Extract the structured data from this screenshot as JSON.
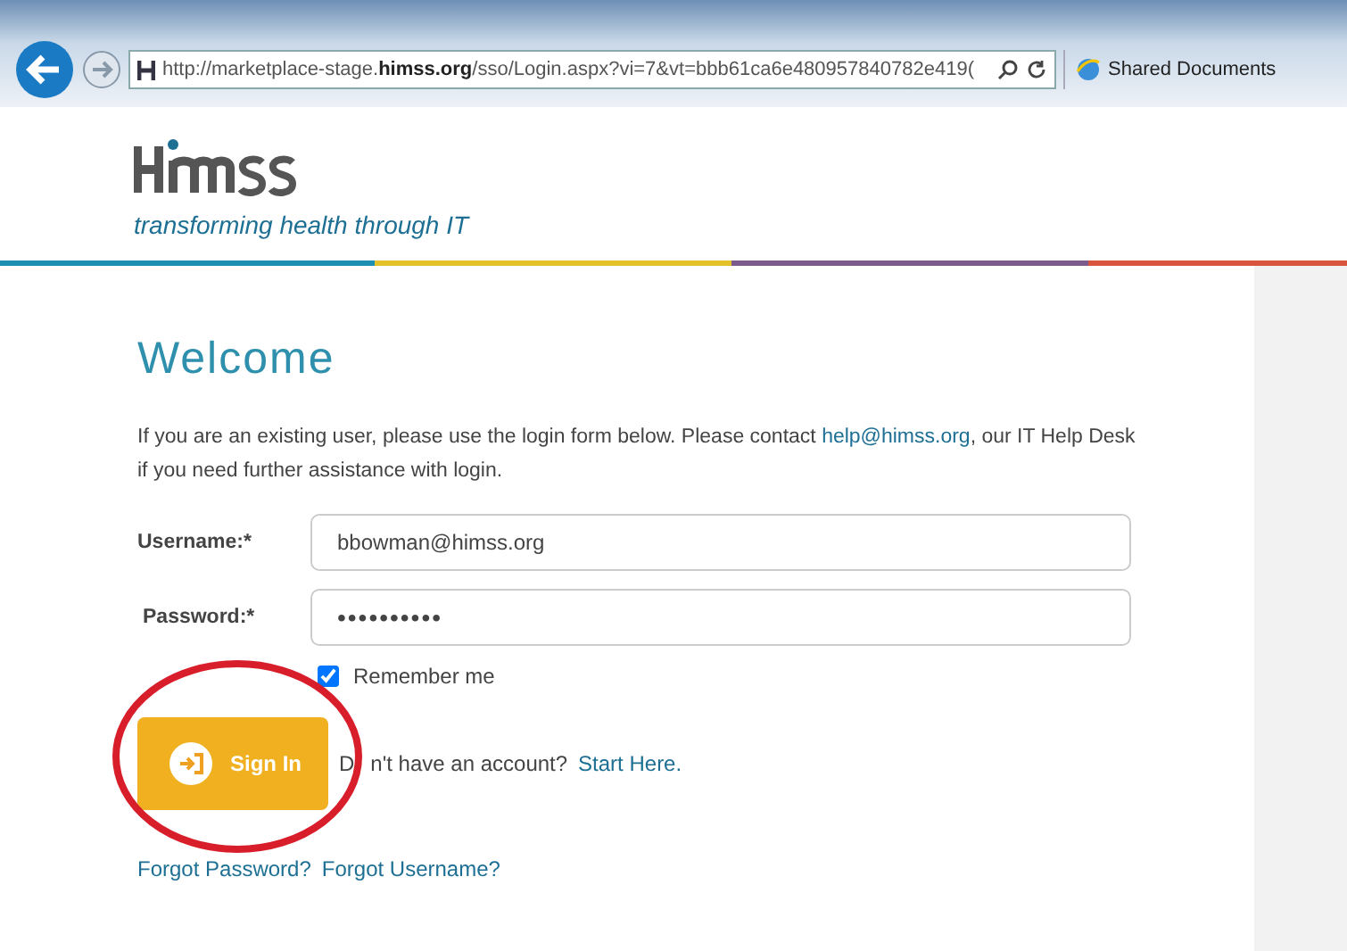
{
  "browser": {
    "address_prefix": "http://marketplace-stage.",
    "address_domain": "himss.org",
    "address_rest": "/sso/Login.aspx?vi=7&vt=bbb61ca6e480957840782e419(",
    "favorite": "Shared Documents"
  },
  "logo": {
    "tagline": "transforming health through IT"
  },
  "welcome": {
    "title": "Welcome",
    "intro_before": "If you are an existing user, please use the login form below. Please contact ",
    "intro_link": "help@himss.org",
    "intro_after": ", our IT Help Desk if you need further assistance with login."
  },
  "form": {
    "username_label": "Username:*",
    "username_value": "bbowman@himss.org",
    "password_label": "Password:*",
    "password_value": "••••••••••",
    "remember": {
      "label": "Remember me",
      "checked": true
    },
    "sign_in": "Sign In",
    "no_account_start": "D",
    "no_account_rest": "n't have an account?",
    "start_here": "Start Here.",
    "forgot_password": "Forgot Password?",
    "forgot_username": "Forgot Username?"
  },
  "annotation": {
    "kind": "circle"
  }
}
